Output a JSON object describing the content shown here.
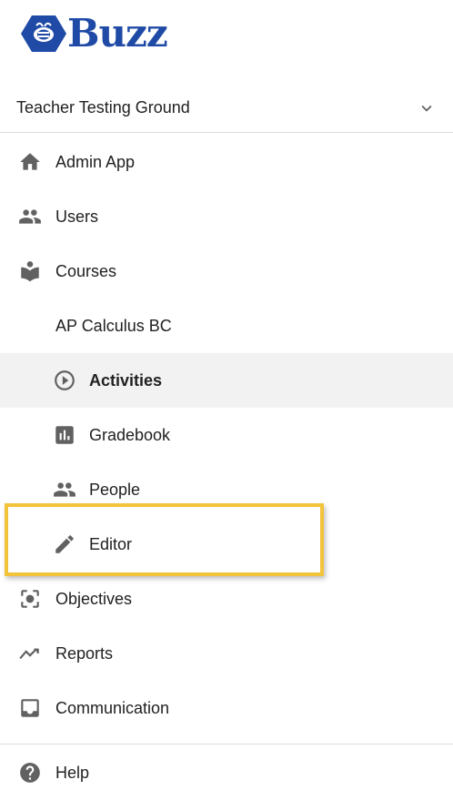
{
  "brand": {
    "logo_text": "Buzz",
    "logo_color": "#1f4aa6"
  },
  "org_selector": {
    "label": "Teacher Testing Ground"
  },
  "nav": {
    "admin_app": "Admin App",
    "users": "Users",
    "courses": "Courses",
    "course_name": "AP Calculus BC",
    "activities": "Activities",
    "gradebook": "Gradebook",
    "people": "People",
    "editor": "Editor",
    "objectives": "Objectives",
    "reports": "Reports",
    "communication": "Communication",
    "help": "Help"
  },
  "colors": {
    "icon": "#616161",
    "highlight_border": "#f2c33b",
    "active_bg": "#f2f2f2"
  }
}
